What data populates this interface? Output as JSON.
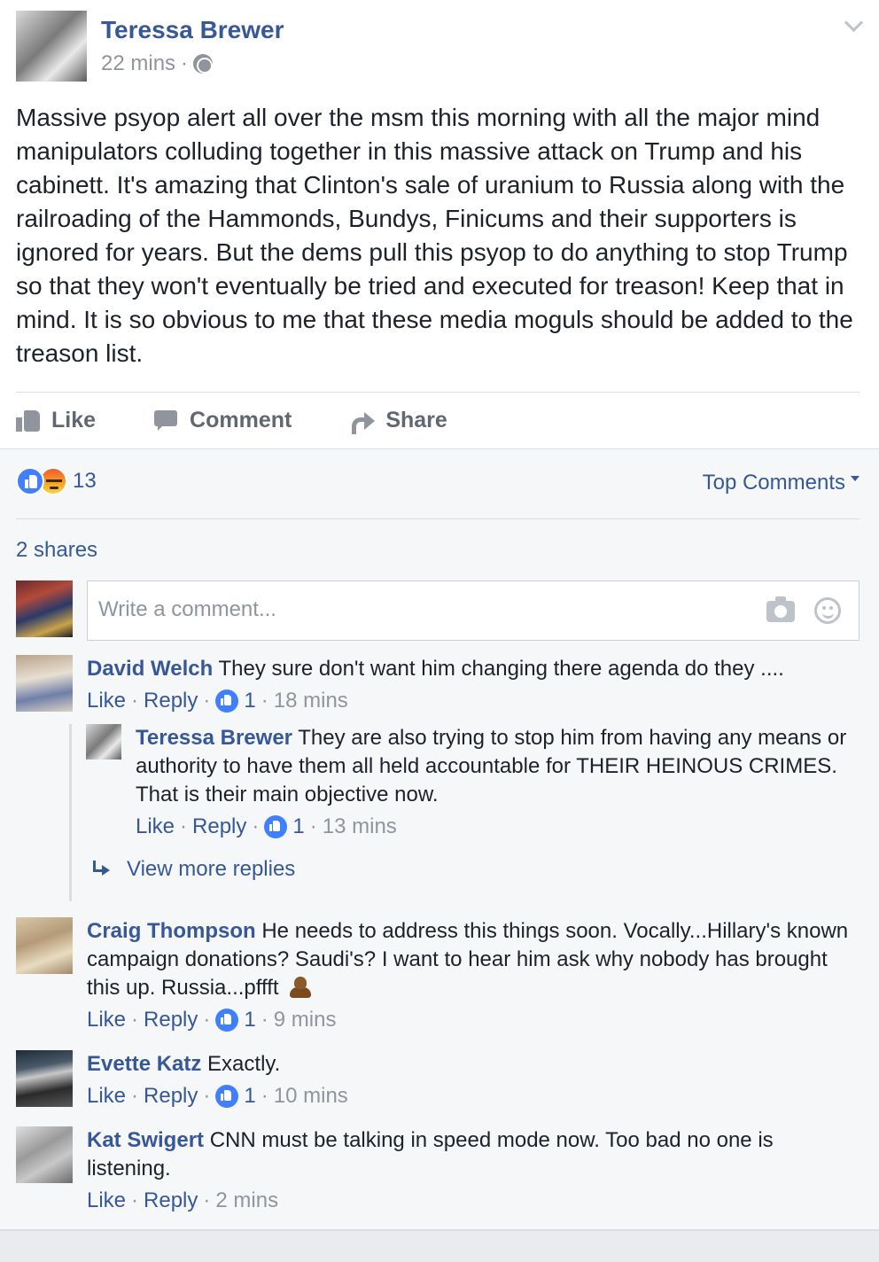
{
  "post": {
    "author": "Teressa Brewer",
    "time": "22 mins",
    "dot": "·",
    "text": "Massive psyop alert all over the msm this morning with all the major mind manipulators colluding together in this massive attack on Trump and his cabinett. It's amazing that Clinton's sale of uranium to Russia along with the railroading of the Hammonds, Bundys, Finicums and their supporters is ignored for years. But the dems pull this psyop to do anything to stop Trump so that they won't eventually be tried and executed for treason! Keep that in mind. It is so obvious to me that these media moguls should be added to the treason list."
  },
  "actions": {
    "like": "Like",
    "comment": "Comment",
    "share": "Share"
  },
  "feedback": {
    "reaction_count": "13",
    "sort_label": "Top Comments",
    "shares": "2 shares",
    "comment_placeholder": "Write a comment..."
  },
  "labels": {
    "like": "Like",
    "reply": "Reply",
    "dot": "·",
    "view_more_replies": "View more replies"
  },
  "comments": [
    {
      "author": "David Welch",
      "text": "They sure don't want him changing there agenda do they ....",
      "likes": "1",
      "time": "18 mins"
    },
    {
      "author": "Teressa Brewer",
      "text": "They are also trying to stop him from having any means or authority to have them all held accountable for THEIR HEINOUS CRIMES. That is their main objective now.",
      "likes": "1",
      "time": "13 mins"
    },
    {
      "author": "Craig Thompson",
      "text": "He needs to address this things soon. Vocally...Hillary's known campaign donations? Saudi's? I want to hear him ask why nobody has brought this up. Russia...pffft",
      "likes": "1",
      "time": "9 mins"
    },
    {
      "author": "Evette Katz",
      "text": "Exactly.",
      "likes": "1",
      "time": "10 mins"
    },
    {
      "author": "Kat Swigert",
      "text": "CNN must be talking in speed mode now. Too bad no one is listening.",
      "time": "2 mins"
    }
  ],
  "colors": {
    "link": "#365899",
    "meta": "#90949c",
    "like_blue": "#4080ff",
    "feedback_bg": "#f6f7f9"
  }
}
